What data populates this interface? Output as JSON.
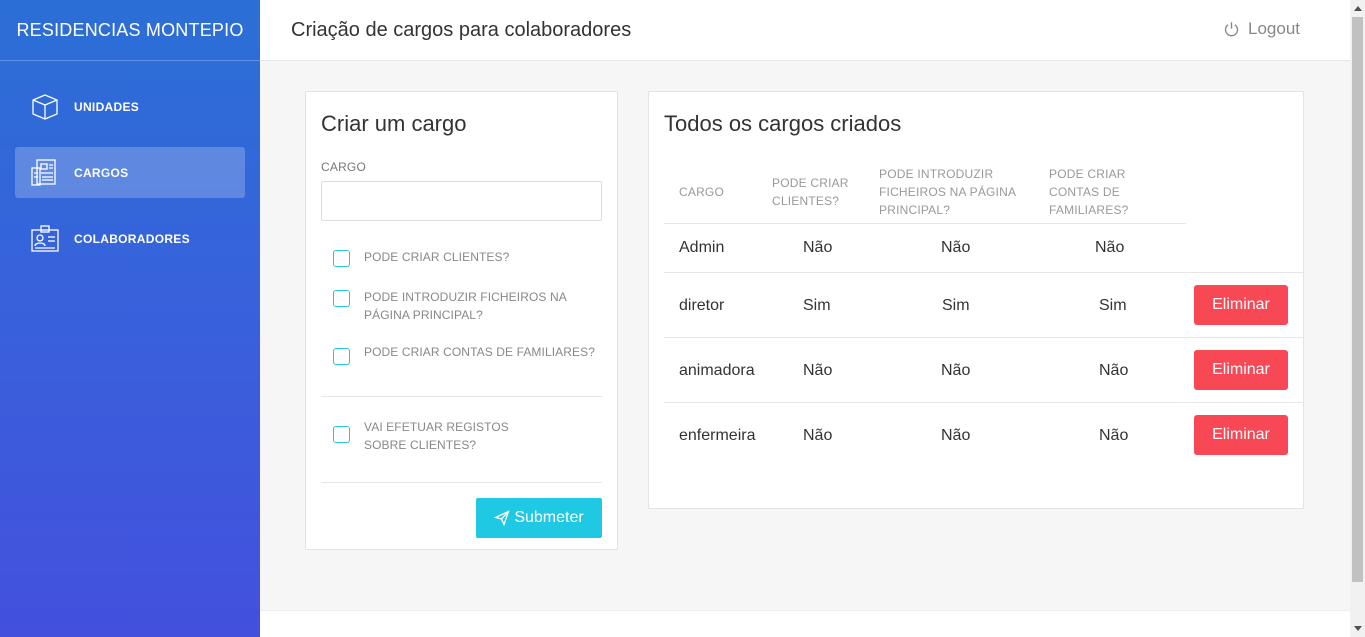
{
  "brand": "RESIDENCIAS MONTEPIO",
  "sidebar": {
    "items": [
      {
        "label": "UNIDADES",
        "icon": "cube-icon"
      },
      {
        "label": "CARGOS",
        "icon": "org-chart-icon",
        "active": true
      },
      {
        "label": "COLABORADORES",
        "icon": "id-badge-icon"
      }
    ]
  },
  "header": {
    "title": "Criação de cargos para colaboradores",
    "logout_label": "Logout"
  },
  "form": {
    "title": "Criar um cargo",
    "cargo_label": "CARGO",
    "cargo_value": "",
    "checks": [
      "PODE CRIAR CLIENTES?",
      "PODE INTRODUZIR FICHEIROS NA PÁGINA PRINCIPAL?",
      "PODE CRIAR CONTAS DE FAMILIARES?",
      "VAI EFETUAR REGISTOS SOBRE CLIENTES?"
    ],
    "submit_label": "Submeter"
  },
  "list": {
    "title": "Todos os cargos criados",
    "headers": {
      "cargo": "CARGO",
      "criar_clientes": "PODE CRIAR CLIENTES?",
      "introduzir_ficheiros": "PODE INTRODUZIR FICHEIROS NA PÁGINA PRINCIPAL?",
      "contas_familiares": "PODE CRIAR CONTAS DE FAMILIARES?"
    },
    "rows": [
      {
        "cargo": "Admin",
        "criar_clientes": "Não",
        "introduzir_ficheiros": "Não",
        "contas_familiares": "Não",
        "action": ""
      },
      {
        "cargo": "diretor",
        "criar_clientes": "Sim",
        "introduzir_ficheiros": "Sim",
        "contas_familiares": "Sim",
        "action": "Eliminar"
      },
      {
        "cargo": "animadora",
        "criar_clientes": "Não",
        "introduzir_ficheiros": "Não",
        "contas_familiares": "Não",
        "action": "Eliminar"
      },
      {
        "cargo": "enfermeira",
        "criar_clientes": "Não",
        "introduzir_ficheiros": "Não",
        "contas_familiares": "Não",
        "action": "Eliminar"
      }
    ]
  },
  "colors": {
    "sidebar_top": "#2b6fd6",
    "sidebar_bottom": "#4350dd",
    "accent": "#1fc8e3",
    "danger": "#f94855"
  }
}
